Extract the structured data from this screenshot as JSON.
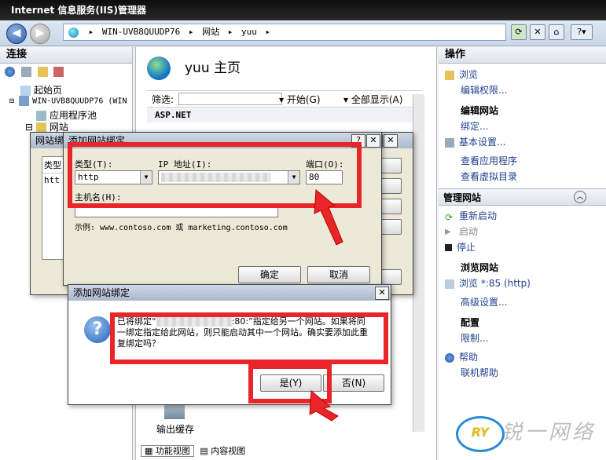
{
  "window": {
    "title": "Internet 信息服务(IIS)管理器"
  },
  "address": {
    "crumbs": [
      "WIN-UVB8QUUDP76",
      "网站",
      "yuu"
    ],
    "help_glyph": "?"
  },
  "left_pane": {
    "title": "连接",
    "tree": [
      {
        "label": "起始页"
      },
      {
        "label": "WIN-UVB8QUUDP76 (WIN"
      },
      {
        "label": "应用程序池"
      },
      {
        "label": "网站"
      }
    ]
  },
  "center_pane": {
    "title": "yuu 主页",
    "filter_label": "筛选:",
    "start_label": "开始(G)",
    "showall_label": "全部显示(A)",
    "group_label": "ASP.NET",
    "output_cache_label": "输出缓存",
    "bottom_tabs": [
      "功能视图",
      "内容视图"
    ]
  },
  "right_pane": {
    "title": "操作",
    "items": [
      {
        "label": "浏览"
      },
      {
        "label": "编辑权限..."
      },
      {
        "label": "编辑网站"
      },
      {
        "label": "绑定..."
      },
      {
        "label": "基本设置..."
      },
      {
        "label": "查看应用程序"
      },
      {
        "label": "查看虚拟目录"
      },
      {
        "label": "管理网站"
      },
      {
        "label": "重新启动"
      },
      {
        "label": "启动"
      },
      {
        "label": "停止"
      },
      {
        "label": "浏览网站"
      },
      {
        "label": "浏览 *:85 (http)"
      },
      {
        "label": "高级设置..."
      },
      {
        "label": "配置"
      },
      {
        "label": "限制..."
      },
      {
        "label": "帮助"
      },
      {
        "label": "联机帮助"
      }
    ]
  },
  "site_bindings_dialog": {
    "title": "网站绑定",
    "col_type": "类型",
    "row_type": "htt"
  },
  "add_binding_dialog": {
    "title": "添加网站绑定",
    "type_label": "类型(T):",
    "type_value": "http",
    "ip_label": "IP 地址(I):",
    "port_label": "端口(O):",
    "port_value": "80",
    "host_label": "主机名(H):",
    "host_value": "",
    "example": "示例: www.contoso.com 或 marketing.contoso.com",
    "ok": "确定",
    "cancel": "取消"
  },
  "confirm_dialog": {
    "title": "添加网站绑定",
    "message_prefix": "已将绑定“",
    "message_suffix": ":80:”指定给另一个网站。如果将同一绑定指定给此网站，则只能启动其中一个网站。确实要添加此重复绑定吗？",
    "yes": "是(Y)",
    "no": "否(N)"
  },
  "watermark": {
    "logo_text": "RY",
    "text": "锐一网络"
  },
  "colors": {
    "highlight": "#e8262a",
    "link": "#1f3f8f"
  }
}
